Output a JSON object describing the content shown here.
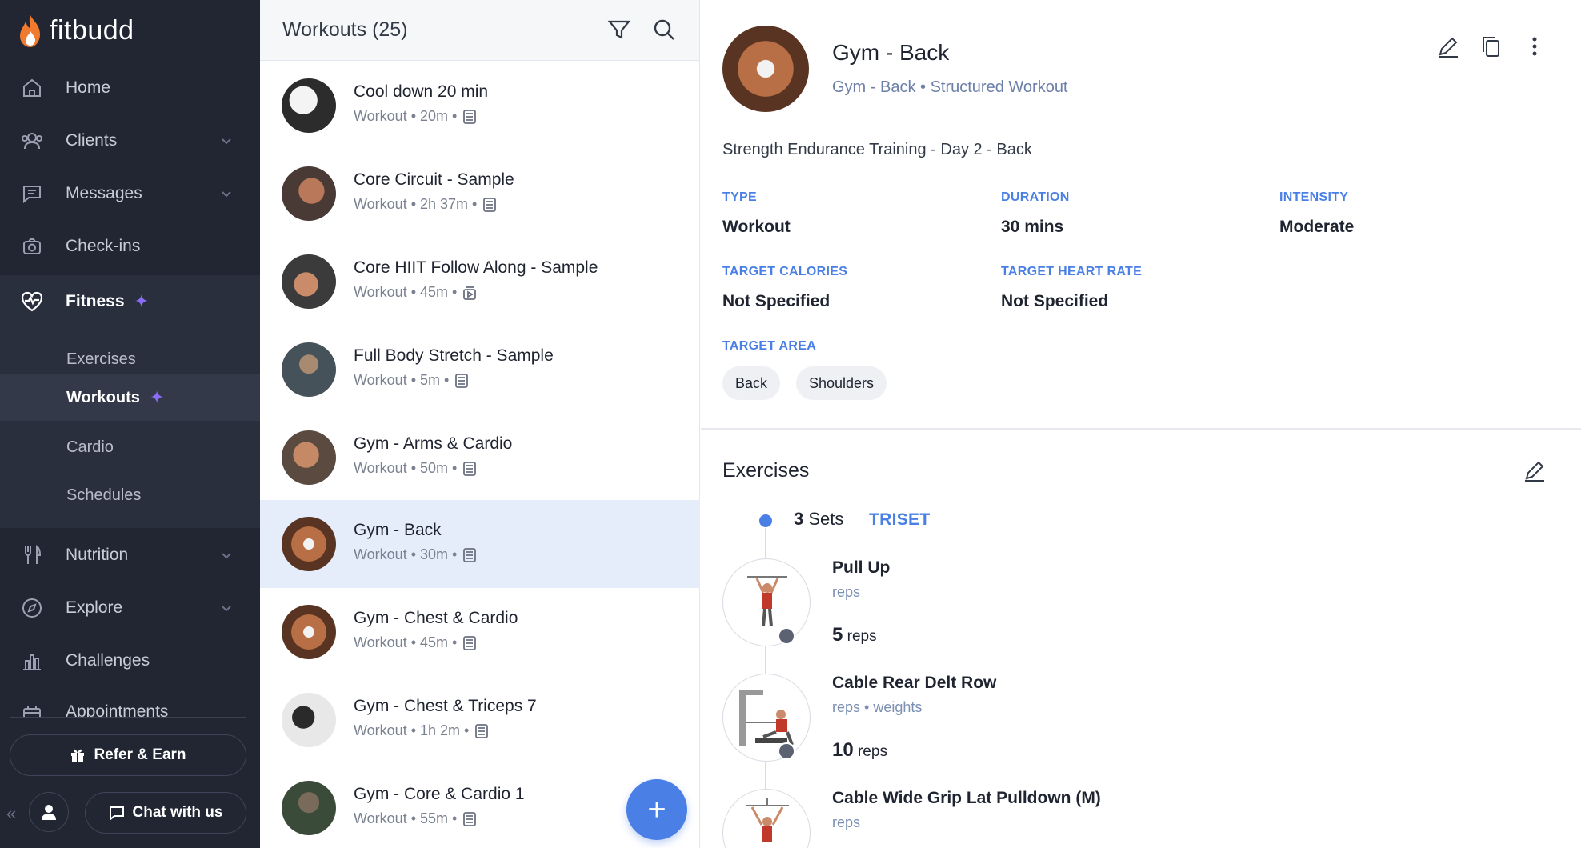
{
  "app": {
    "brand": "fitbudd"
  },
  "sidebar": {
    "items": [
      {
        "label": "Home",
        "icon": "home-icon"
      },
      {
        "label": "Clients",
        "icon": "users-icon"
      },
      {
        "label": "Messages",
        "icon": "message-icon"
      },
      {
        "label": "Check-ins",
        "icon": "camera-icon"
      },
      {
        "label": "Fitness",
        "icon": "heart-pulse-icon"
      },
      {
        "label": "Nutrition",
        "icon": "utensils-icon"
      },
      {
        "label": "Explore",
        "icon": "compass-icon"
      },
      {
        "label": "Challenges",
        "icon": "chart-icon"
      },
      {
        "label": "Appointments",
        "icon": "calendar-icon"
      }
    ],
    "fitness_sub": [
      "Exercises",
      "Workouts",
      "Cardio",
      "Schedules"
    ],
    "refer_label": "Refer & Earn",
    "chat_label": "Chat with us"
  },
  "list": {
    "title": "Workouts (25)",
    "items": [
      {
        "name": "Cool down 20 min",
        "meta": "Workout • 20m •"
      },
      {
        "name": "Core Circuit - Sample",
        "meta": "Workout • 2h 37m •"
      },
      {
        "name": "Core HIIT Follow Along - Sample",
        "meta": "Workout • 45m •"
      },
      {
        "name": "Full Body Stretch - Sample",
        "meta": "Workout • 5m •"
      },
      {
        "name": "Gym - Arms & Cardio",
        "meta": "Workout • 50m •"
      },
      {
        "name": "Gym - Back",
        "meta": "Workout • 30m •"
      },
      {
        "name": "Gym - Chest & Cardio",
        "meta": "Workout • 45m •"
      },
      {
        "name": "Gym - Chest & Triceps 7",
        "meta": "Workout • 1h 2m •"
      },
      {
        "name": "Gym - Core & Cardio 1",
        "meta": "Workout • 55m •"
      }
    ],
    "fab_label": "+"
  },
  "detail": {
    "title": "Gym - Back",
    "subtitle": "Gym - Back • Structured Workout",
    "description": "Strength Endurance Training - Day 2 - Back",
    "fields": {
      "type_label": "TYPE",
      "type_value": "Workout",
      "duration_label": "DURATION",
      "duration_value": "30 mins",
      "intensity_label": "INTENSITY",
      "intensity_value": "Moderate",
      "calories_label": "TARGET CALORIES",
      "calories_value": "Not Specified",
      "heart_label": "TARGET HEART RATE",
      "heart_value": "Not Specified",
      "area_label": "TARGET AREA"
    },
    "target_areas": [
      "Back",
      "Shoulders"
    ],
    "exercises_title": "Exercises",
    "set": {
      "count": "3",
      "label": "Sets",
      "tag": "TRISET"
    },
    "exercises": [
      {
        "name": "Pull Up",
        "meta": "reps",
        "reps_value": "5",
        "reps_unit": "reps"
      },
      {
        "name": "Cable Rear Delt Row",
        "meta": "reps • weights",
        "reps_value": "10",
        "reps_unit": "reps"
      },
      {
        "name": "Cable Wide Grip Lat Pulldown (M)",
        "meta": "reps"
      }
    ]
  },
  "colors": {
    "sidebar_bg": "#222633",
    "accent": "#4a7fe6",
    "selected_row": "#e5edfb",
    "sparkle": "#8b6cf7"
  }
}
